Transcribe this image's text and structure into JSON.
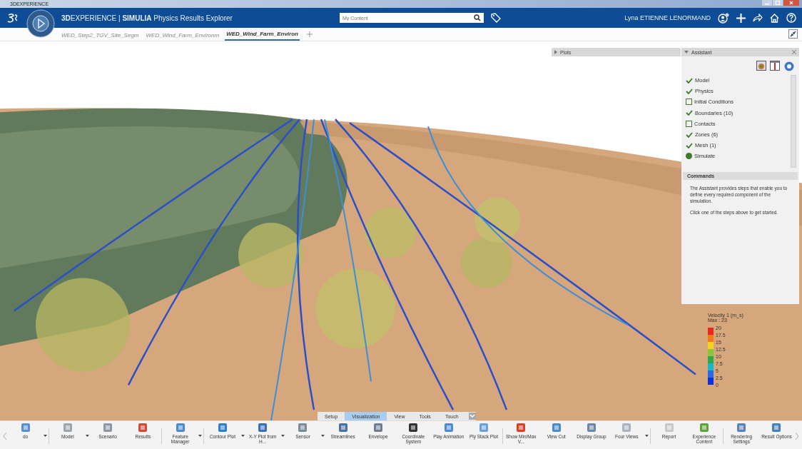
{
  "window": {
    "title": "3DEXPERIENCE"
  },
  "header": {
    "title": "**3D**EXPERIENCE | **SIMULIA** Physics Results Explorer",
    "search": {
      "placeholder": "My Content"
    },
    "user": "Lyna ETIENNE LENORMAND"
  },
  "tabs": [
    {
      "label": "WED_Step2_TGV_Site_Segm",
      "selected": false
    },
    {
      "label": "WED_Wind_Farm_Environm",
      "selected": false
    },
    {
      "label": "WED_Wind_Farm_Environ",
      "selected": true
    }
  ],
  "plots_panel": {
    "title": "Plots"
  },
  "assistant": {
    "title": "Assistant",
    "steps": [
      {
        "label": "Model",
        "kind": "done"
      },
      {
        "label": "Physics",
        "kind": "done"
      },
      {
        "label": "Initial Conditions",
        "kind": "todo"
      },
      {
        "label": "Boundaries (10)",
        "kind": "done"
      },
      {
        "label": "Contacts",
        "kind": "todo"
      },
      {
        "label": "Zones (6)",
        "kind": "done"
      },
      {
        "label": "Mesh (1)",
        "kind": "done"
      },
      {
        "label": "Simulate",
        "kind": "current"
      }
    ],
    "commands_title": "Commands",
    "paragraphs": [
      "The Assistant provides steps that enable you to define every required component of the simulation.",
      "Click one of the steps above to get started."
    ]
  },
  "legend": {
    "title": "Velocity 1 (m_s)",
    "max": "Max : 23",
    "ticks": [
      "20",
      "17.5",
      "15",
      "12.5",
      "10",
      "7.5",
      "5",
      "2.5",
      "0"
    ]
  },
  "section_tabs": [
    {
      "label": "Setup",
      "selected": false
    },
    {
      "label": "Visualization",
      "selected": true
    },
    {
      "label": "View",
      "selected": false
    },
    {
      "label": "Tools",
      "selected": false
    },
    {
      "label": "Touch",
      "selected": false
    }
  ],
  "toolbar": [
    {
      "label": "do",
      "dropdown": true,
      "separator_after": true
    },
    {
      "label": "Model",
      "dropdown": true,
      "separator_after": false
    },
    {
      "label": "Scenario",
      "dropdown": false,
      "separator_after": false
    },
    {
      "label": "Results",
      "dropdown": false,
      "separator_after": true
    },
    {
      "label": "Feature Manager",
      "dropdown": true,
      "separator_after": true
    },
    {
      "label": "Contour Plot",
      "dropdown": true,
      "separator_after": false
    },
    {
      "label": "X-Y Plot from H...",
      "dropdown": true,
      "separator_after": false
    },
    {
      "label": "Sensor",
      "dropdown": true,
      "separator_after": false
    },
    {
      "label": "Streamlines",
      "dropdown": false,
      "separator_after": false
    },
    {
      "label": "Envelope",
      "dropdown": false,
      "separator_after": false
    },
    {
      "label": "Coordinate System",
      "dropdown": false,
      "separator_after": false
    },
    {
      "label": "Play Animation",
      "dropdown": false,
      "separator_after": false
    },
    {
      "label": "Ply Stack Plot",
      "dropdown": false,
      "separator_after": true
    },
    {
      "label": "Show Min/Max V...",
      "dropdown": false,
      "separator_after": false
    },
    {
      "label": "View Cut",
      "dropdown": false,
      "separator_after": false
    },
    {
      "label": "Display Group",
      "dropdown": false,
      "separator_after": false
    },
    {
      "label": "Four Views",
      "dropdown": true,
      "separator_after": true
    },
    {
      "label": "Report",
      "dropdown": false,
      "separator_after": false
    },
    {
      "label": "Experience Content",
      "dropdown": false,
      "separator_after": true
    },
    {
      "label": "Rendering Settings",
      "dropdown": false,
      "separator_after": false
    },
    {
      "label": "Result Options",
      "dropdown": false,
      "separator_after": false
    }
  ]
}
